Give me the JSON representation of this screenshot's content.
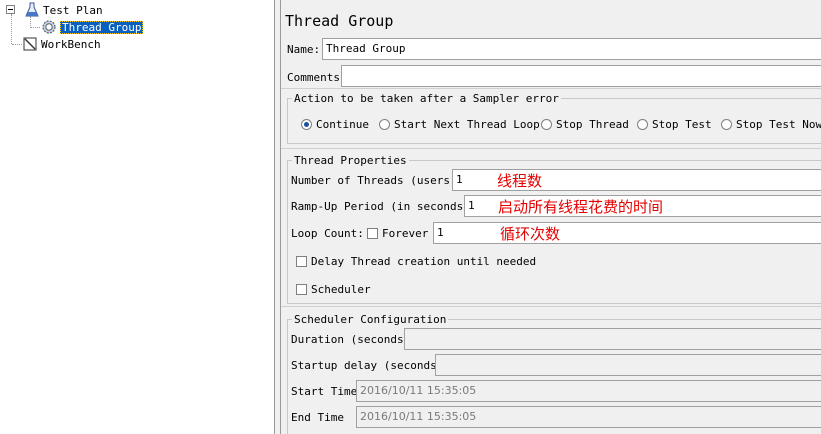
{
  "tree": {
    "test_plan": "Test Plan",
    "thread_group": "Thread Group",
    "workbench": "WorkBench"
  },
  "panel": {
    "title": "Thread Group",
    "name_label": "Name:",
    "name_value": "Thread Group",
    "comments_label": "Comments:",
    "comments_value": ""
  },
  "sampler_error": {
    "legend": "Action to be taken after a Sampler error",
    "options": [
      "Continue",
      "Start Next Thread Loop",
      "Stop Thread",
      "Stop Test",
      "Stop Test Now"
    ],
    "selected": "Continue"
  },
  "thread_properties": {
    "legend": "Thread Properties",
    "threads_label": "Number of Threads (users):",
    "threads_value": "1",
    "threads_note": "线程数",
    "rampup_label": "Ramp-Up Period (in seconds):",
    "rampup_value": "1",
    "rampup_note": "启动所有线程花费的时间",
    "loop_label": "Loop Count:",
    "forever_label": "Forever",
    "forever_checked": false,
    "loop_value": "1",
    "loop_note": "循环次数",
    "delay_label": "Delay Thread creation until needed",
    "delay_checked": false,
    "scheduler_label": "Scheduler",
    "scheduler_checked": false
  },
  "scheduler_config": {
    "legend": "Scheduler Configuration",
    "duration_label": "Duration (seconds)",
    "duration_value": "",
    "startup_label": "Startup delay (seconds)",
    "startup_value": "",
    "start_time_label": "Start Time",
    "start_time_value": "2016/10/11 15:35:05",
    "end_time_label": "End Time",
    "end_time_value": "2016/10/11 15:35:05"
  },
  "colors": {
    "selection": "#0a5fbf",
    "annotation": "#e60000",
    "radio_dot": "#1e50a0"
  }
}
